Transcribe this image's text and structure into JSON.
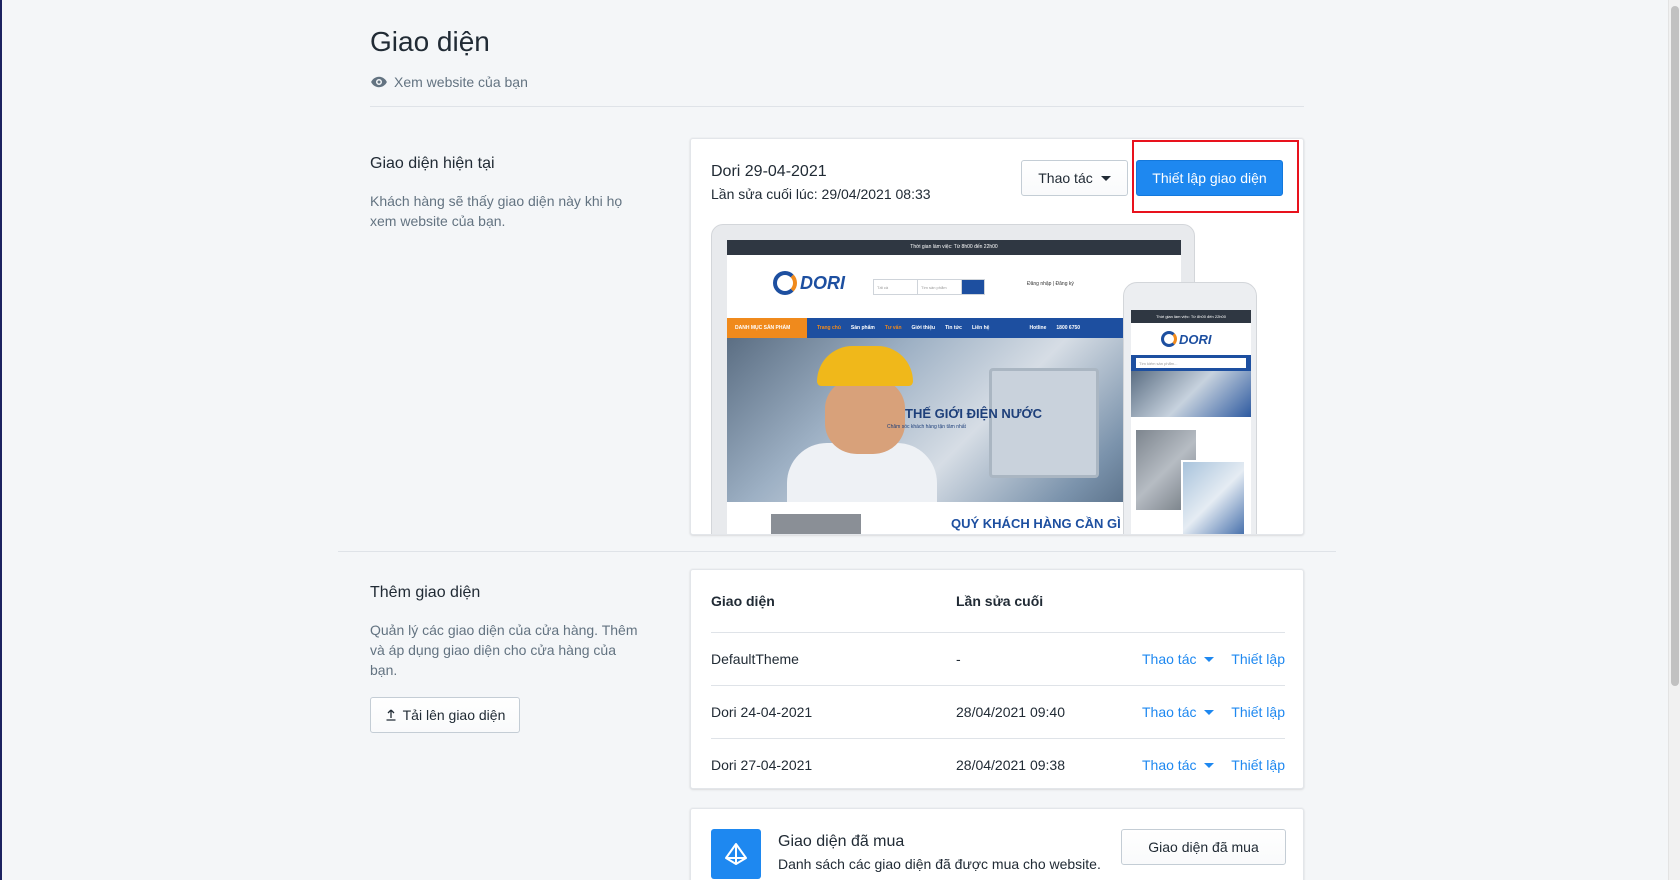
{
  "page": {
    "title": "Giao diện",
    "view_website": "Xem website của bạn"
  },
  "current_theme": {
    "section_title": "Giao diện hiện tại",
    "section_desc": "Khách hàng sẽ thấy giao diện này khi họ xem website của bạn.",
    "name": "Dori 29-04-2021",
    "last_edited": "Lần sửa cuối lúc: 29/04/2021 08:33",
    "actions_label": "Thao tác",
    "setup_label": "Thiết lập giao diện"
  },
  "preview": {
    "topbar_text": "Thời gian làm việc: Từ 8h00 đến 22h00",
    "logo_text": "DORI",
    "search_cat": "Tất cả",
    "search_placeholder": "Tìm sản phẩm",
    "account_text": "Đăng nhập | Đăng ký",
    "nav_category": "DANH MỤC SẢN PHẨM",
    "nav_items": [
      "Trang chủ",
      "Sản phẩm",
      "Tư vấn",
      "Giới thiệu",
      "Tin tức",
      "Liên hệ"
    ],
    "hotline_label": "Hotline",
    "hotline_number": "1800 6750",
    "hero_title": "THẾ GIỚI ĐIỆN NƯỚC",
    "hero_sub": "Chăm sóc khách hàng tận tâm nhất",
    "bottom_caption": "QUÝ KHÁCH HÀNG CẦN GÌ",
    "mobile_search_placeholder": "Tìm kiếm sản phẩm..."
  },
  "add_theme": {
    "section_title": "Thêm giao diện",
    "section_desc": "Quản lý các giao diện của cửa hàng. Thêm và áp dụng giao diện cho cửa hàng của bạn.",
    "upload_label": "Tải lên giao diện"
  },
  "themes_table": {
    "col_theme": "Giao diện",
    "col_last_edited": "Lần sửa cuối",
    "action_label": "Thao tác",
    "setup_label": "Thiết lập",
    "rows": [
      {
        "name": "DefaultTheme",
        "edited": "-"
      },
      {
        "name": "Dori 24-04-2021",
        "edited": "28/04/2021 09:40"
      },
      {
        "name": "Dori 27-04-2021",
        "edited": "28/04/2021 09:38"
      }
    ]
  },
  "purchased": {
    "title": "Giao diện đã mua",
    "desc": "Danh sách các giao diện đã được mua cho website.",
    "button_label": "Giao diện đã mua"
  },
  "colors": {
    "primary": "#1e88f0",
    "highlight": "#e8121d",
    "brand_blue": "#1d4fa0",
    "brand_orange": "#f08a1c"
  }
}
